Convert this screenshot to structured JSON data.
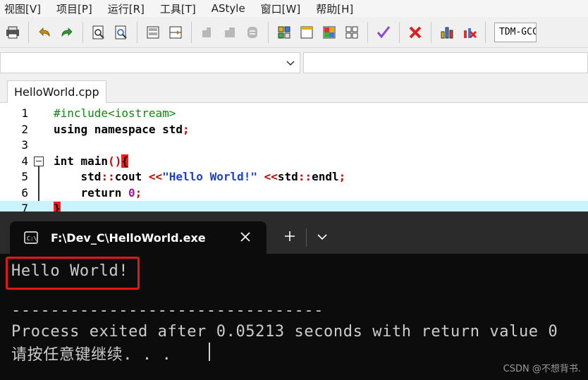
{
  "menu": [
    "视图[V]",
    "项目[P]",
    "运行[R]",
    "工具[T]",
    "AStyle",
    "窗口[W]",
    "帮助[H]"
  ],
  "toolbar": {
    "compiler": "TDM-GCC"
  },
  "tab": {
    "label": "HelloWorld.cpp"
  },
  "editor": {
    "lines": [
      {
        "n": "1"
      },
      {
        "n": "2"
      },
      {
        "n": "3"
      },
      {
        "n": "4"
      },
      {
        "n": "5"
      },
      {
        "n": "6"
      },
      {
        "n": "7"
      }
    ],
    "code": {
      "l1": "#include<iostream>",
      "l2a": "using namespace std",
      "l2b": ";",
      "l4a": "int main",
      "l4b": "()",
      "l4c": "{",
      "l5a": "    std",
      "l5b": "::",
      "l5c": "cout ",
      "l5d": "<<",
      "l5e": "\"Hello World!\"",
      "l5f": " <<",
      "l5g": "std",
      "l5h": "::",
      "l5i": "endl",
      "l5j": ";",
      "l6a": "    return ",
      "l6b": "0",
      "l6c": ";",
      "l7": "}"
    }
  },
  "console": {
    "title": "F:\\Dev_C\\HelloWorld.exe",
    "output1": "Hello World!",
    "dashes": "--------------------------------",
    "process": "Process exited after 0.05213 seconds with return value 0",
    "prompt": "请按任意键继续. . ."
  },
  "watermark": "CSDN @不想背书."
}
